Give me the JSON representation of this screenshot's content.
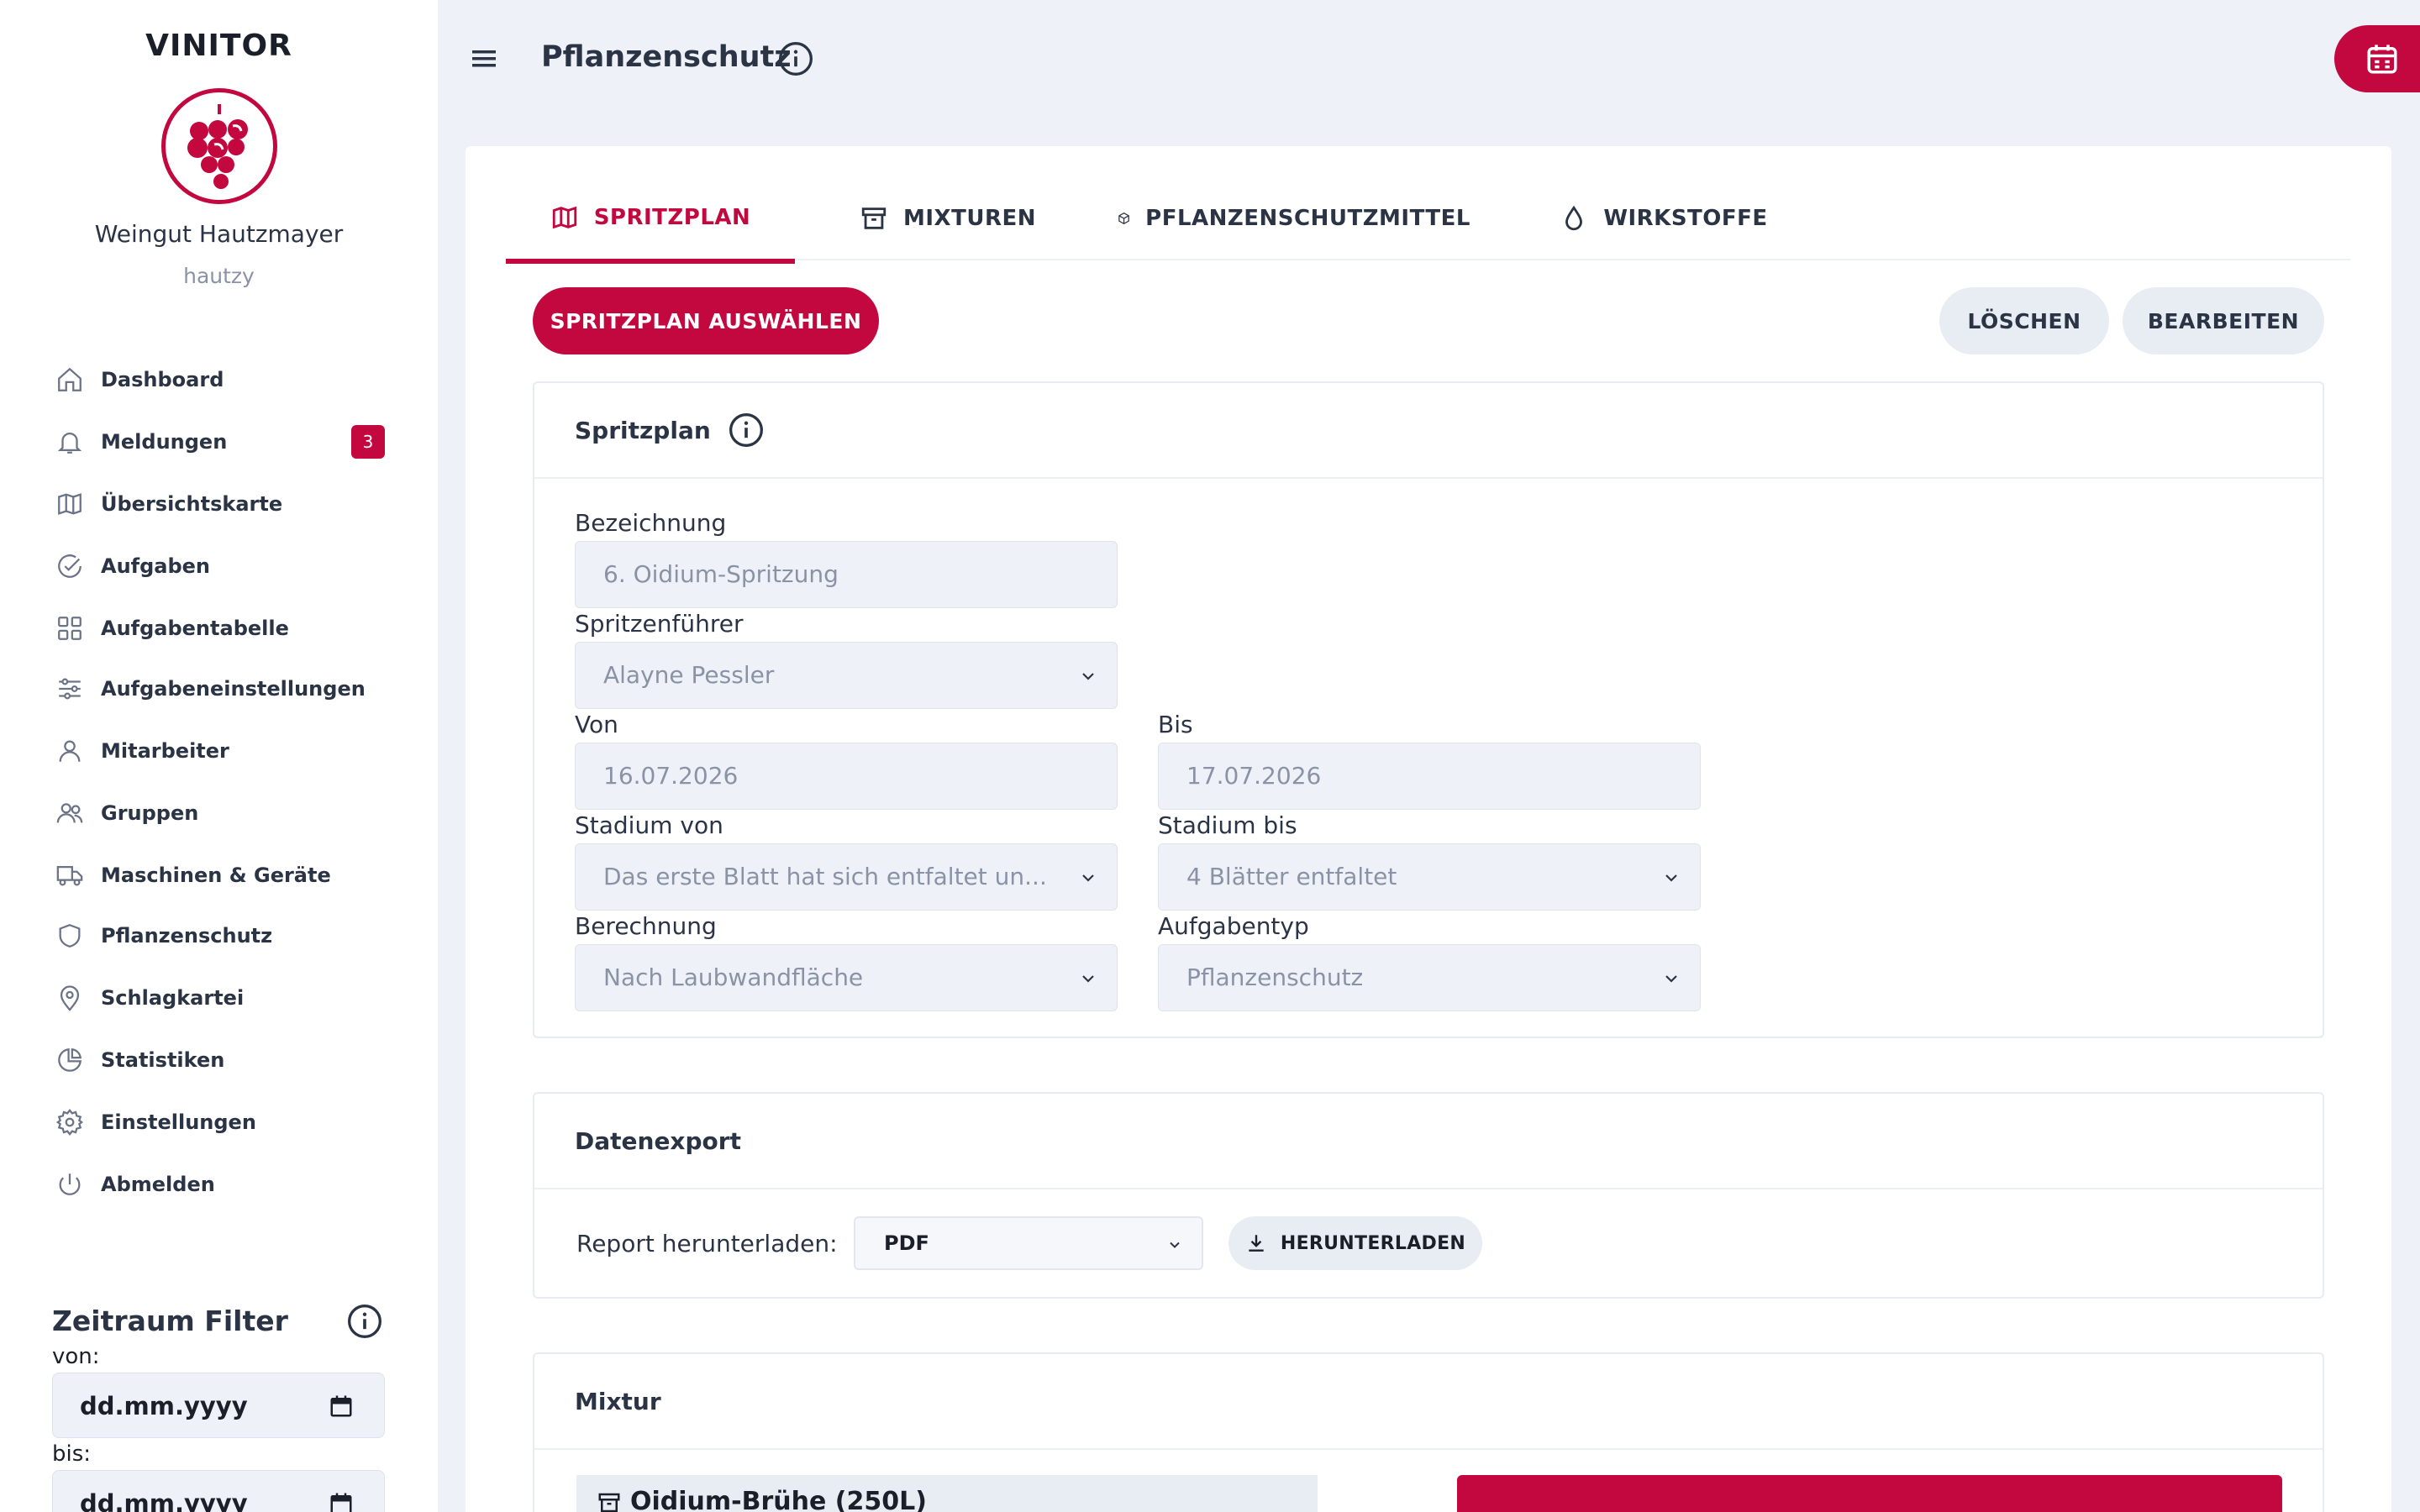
{
  "app": {
    "brand": "VINITOR",
    "org_name": "Weingut Hautzmayer",
    "user_name": "hautzy",
    "accent_color": "#c3073f"
  },
  "sidebar": {
    "items": [
      {
        "label": "Dashboard",
        "icon": "home-icon"
      },
      {
        "label": "Meldungen",
        "icon": "bell-icon",
        "badge": "3"
      },
      {
        "label": "Übersichtskarte",
        "icon": "map-icon"
      },
      {
        "label": "Aufgaben",
        "icon": "check-circle-icon"
      },
      {
        "label": "Aufgabentabelle",
        "icon": "grid-icon"
      },
      {
        "label": "Aufgabeneinstellungen",
        "icon": "sliders-icon"
      },
      {
        "label": "Mitarbeiter",
        "icon": "user-icon"
      },
      {
        "label": "Gruppen",
        "icon": "users-icon"
      },
      {
        "label": "Maschinen & Geräte",
        "icon": "truck-icon"
      },
      {
        "label": "Pflanzenschutz",
        "icon": "shield-icon"
      },
      {
        "label": "Schlagkartei",
        "icon": "map-pin-icon"
      },
      {
        "label": "Statistiken",
        "icon": "pie-chart-icon"
      },
      {
        "label": "Einstellungen",
        "icon": "gear-icon"
      },
      {
        "label": "Abmelden",
        "icon": "power-icon"
      }
    ]
  },
  "filter": {
    "title": "Zeitraum Filter",
    "from_label": "von:",
    "from_value": "dd.mm.yyyy",
    "to_label": "bis:",
    "to_value": "dd.mm.yyyy"
  },
  "header": {
    "title": "Pflanzenschutz"
  },
  "tabs": [
    {
      "label": "SPRITZPLAN",
      "icon": "map-icon",
      "active": true
    },
    {
      "label": "MIXTUREN",
      "icon": "archive-icon",
      "active": false
    },
    {
      "label": "PFLANZENSCHUTZMITTEL",
      "icon": "box-icon",
      "active": false
    },
    {
      "label": "WIRKSTOFFE",
      "icon": "droplet-icon",
      "active": false
    }
  ],
  "actions": {
    "select_plan": "SPRITZPLAN AUSWÄHLEN",
    "delete": "LÖSCHEN",
    "edit": "BEARBEITEN"
  },
  "spritzplan": {
    "title": "Spritzplan",
    "bezeichnung_label": "Bezeichnung",
    "bezeichnung_value": "6. Oidium-Spritzung",
    "fahrer_label": "Spritzenführer",
    "fahrer_value": "Alayne Pessler",
    "von_label": "Von",
    "von_value": "16.07.2026",
    "bis_label": "Bis",
    "bis_value": "17.07.2026",
    "stadium_von_label": "Stadium von",
    "stadium_von_value": "Das erste Blatt hat sich entfaltet un...",
    "stadium_bis_label": "Stadium bis",
    "stadium_bis_value": "4 Blätter entfaltet",
    "berechnung_label": "Berechnung",
    "berechnung_value": "Nach Laubwandfläche",
    "aufgabentyp_label": "Aufgabentyp",
    "aufgabentyp_value": "Pflanzenschutz"
  },
  "export": {
    "title": "Datenexport",
    "report_label": "Report herunterladen:",
    "format_value": "PDF",
    "download_label": "HERUNTERLADEN"
  },
  "mixtur": {
    "title": "Mixtur",
    "item_label": "Oidium-Brühe (250L)"
  }
}
